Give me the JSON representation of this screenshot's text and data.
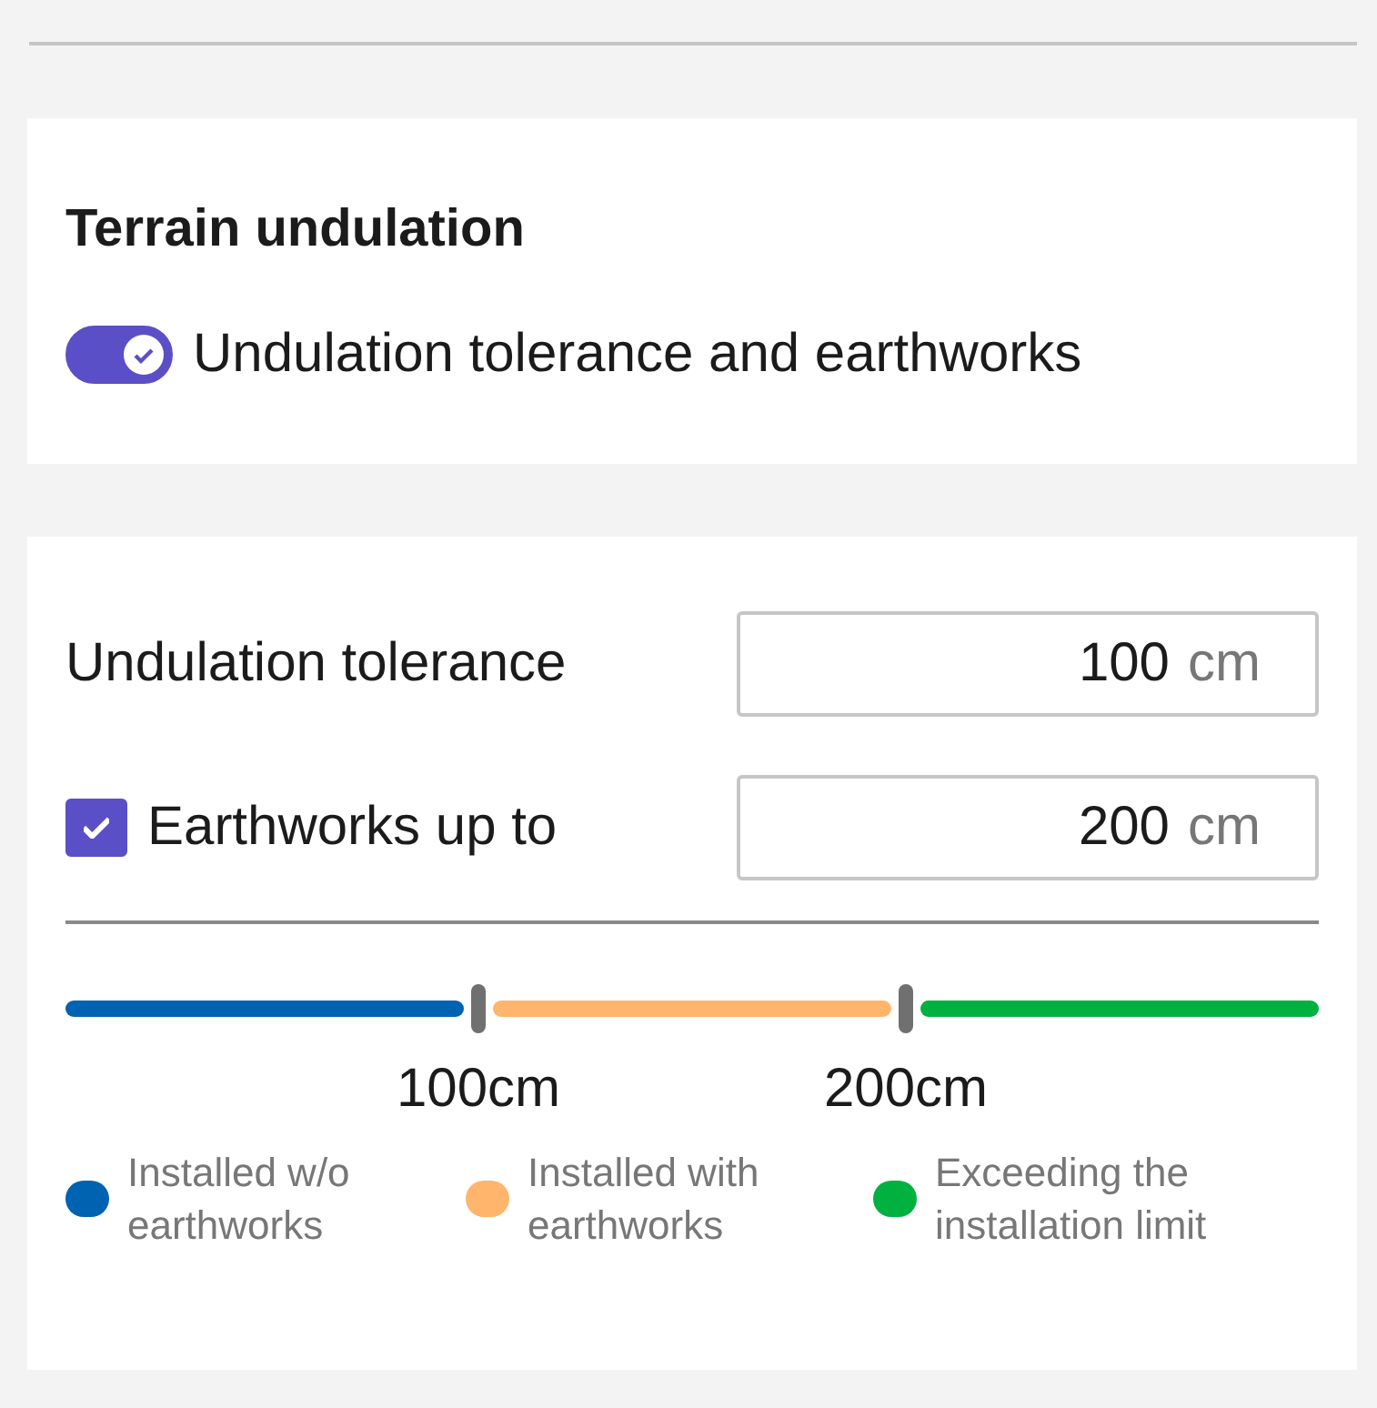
{
  "section": {
    "title": "Terrain undulation",
    "toggle": {
      "label": "Undulation tolerance and earthworks",
      "on": true
    }
  },
  "fields": [
    {
      "kind": "plain",
      "label": "Undulation tolerance",
      "value": "100",
      "unit": "cm"
    },
    {
      "kind": "checkbox",
      "checked": true,
      "label": "Earthworks up to",
      "value": "200",
      "unit": "cm"
    }
  ],
  "scale": {
    "segments": [
      {
        "color": "#0063b1"
      },
      {
        "color": "#ffb56b"
      },
      {
        "color": "#00b140"
      }
    ],
    "thresholds": [
      "100cm",
      "200cm"
    ]
  },
  "legend": [
    {
      "color": "#0063b1",
      "label": "Installed w/o earthworks"
    },
    {
      "color": "#ffb56b",
      "label": "Installed with earthworks"
    },
    {
      "color": "#00b140",
      "label": "Exceeding the installation limit"
    }
  ]
}
